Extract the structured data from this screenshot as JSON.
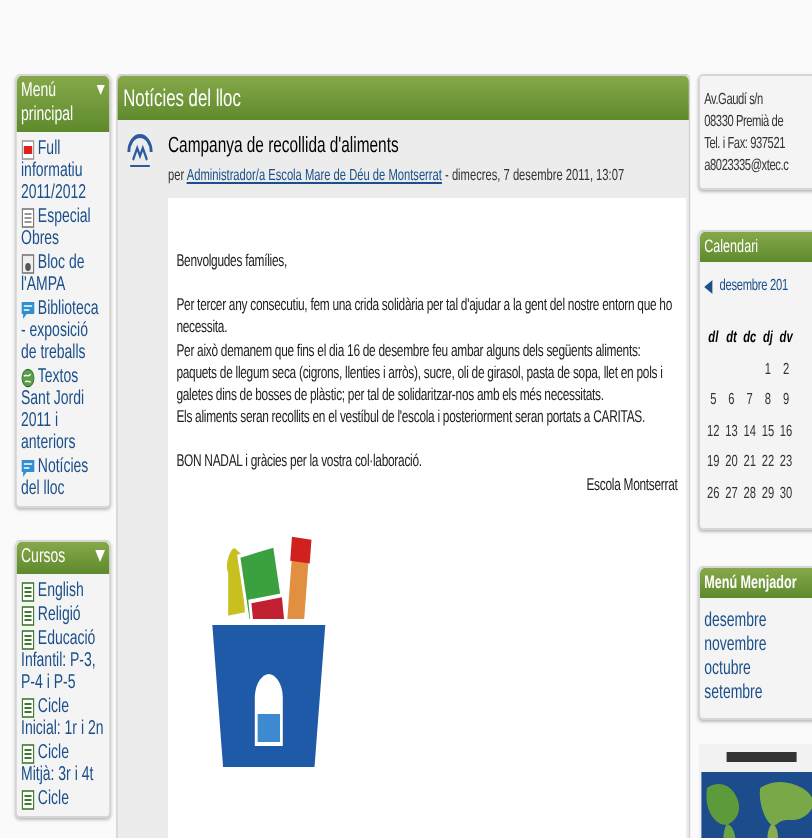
{
  "left_blocks": [
    {
      "title": "Menú principal",
      "items": [
        {
          "kind": "pdf",
          "label": "Full informatiu 2011/2012"
        },
        {
          "kind": "page",
          "label": "Especial Obres"
        },
        {
          "kind": "blog",
          "label": "Bloc de l'AMPA"
        },
        {
          "kind": "chat",
          "label": "Biblioteca - exposició de treballs"
        },
        {
          "kind": "globe",
          "label": "Textos Sant Jordi 2011 i anteriors"
        },
        {
          "kind": "chat",
          "label": "Notícies del lloc"
        }
      ]
    },
    {
      "title": "Cursos",
      "items": [
        {
          "kind": "course",
          "label": "English"
        },
        {
          "kind": "course",
          "label": "Religió"
        },
        {
          "kind": "course",
          "label": "Educació Infantil: P-3, P-4 i P-5"
        },
        {
          "kind": "course",
          "label": "Cicle Inicial: 1r i 2n"
        },
        {
          "kind": "course",
          "label": "Cicle Mitjà: 3r i 4t"
        },
        {
          "kind": "course",
          "label": "Cicle"
        }
      ]
    }
  ],
  "news": {
    "title": "Notícies del lloc",
    "post": {
      "title": "Campanya de recollida d'aliments",
      "by": "per",
      "author": "Administrador/a Escola Mare de Déu de Montserrat",
      "date": "- dimecres, 7 desembre 2011, 13:07",
      "body": [
        [
          "Benvolgudes famílies,"
        ],
        [
          "Per tercer any consecutiu, fem una crida solidària per tal d'ajudar a la gent del nostre entorn que ho necessita.",
          "Per això demanem que fins el dia 16 de desembre feu ambar alguns dels següents aliments: paquets de llegum seca (cigrons, llenties i arròs), sucre, oli de girasol, pasta de sopa, llet en pols i galetes dins de bosses de plàstic; per tal de solidaritzar-nos amb els més necessitats.",
          "Els aliments seran recollits en el vestíbul de l'escola i posteriorment seran portats a CARITAS."
        ],
        [
          "BON NADAL i gràcies per la vostra col·laboració."
        ]
      ],
      "signature": "Escola Montserrat"
    }
  },
  "address": [
    "Av.Gaudí s/n",
    "08330 Premià de",
    "Tel. i Fax: 937521",
    "a8023335@xtec.c"
  ],
  "calendar": {
    "title": "Calendari",
    "month": "desembre 201",
    "weekdays": [
      "dl",
      "dt",
      "dc",
      "dj",
      "dv"
    ],
    "weeks": [
      {
        "kind": "first",
        "days": [
          "1",
          "2"
        ]
      },
      {
        "kind": "full",
        "days": [
          "5",
          "6",
          "7",
          "8",
          "9"
        ]
      },
      {
        "kind": "full",
        "days": [
          "12",
          "13",
          "14",
          "15",
          "16"
        ]
      },
      {
        "kind": "full",
        "days": [
          "19",
          "20",
          "21",
          "22",
          "23"
        ]
      },
      {
        "kind": "full",
        "days": [
          "26",
          "27",
          "28",
          "29",
          "30"
        ]
      }
    ]
  },
  "menjador": {
    "title": "Menú Menjador",
    "items": [
      "desembre",
      "novembre",
      "octubre",
      "setembre"
    ]
  }
}
